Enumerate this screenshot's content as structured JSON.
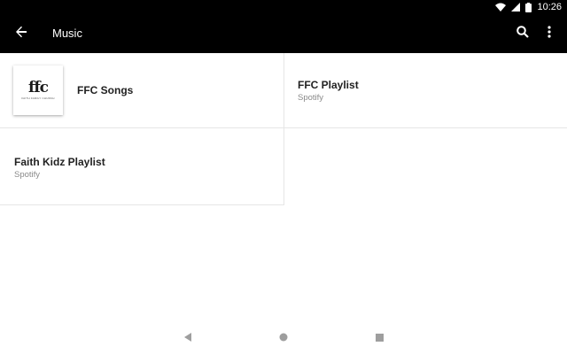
{
  "status_bar": {
    "time": "10:26",
    "icons": [
      "wifi-icon",
      "cell-signal-icon",
      "battery-icon"
    ]
  },
  "app_bar": {
    "title": "Music",
    "icons": [
      "arrow-back-icon",
      "search-icon",
      "more-vert-icon"
    ]
  },
  "tiles": [
    {
      "title": "FFC Songs",
      "subtitle": "",
      "thumbnail_text": "ffc",
      "thumbnail_subtext": "FAITH FAMILY CHURCH"
    },
    {
      "title": "FFC Playlist",
      "subtitle": "Spotify"
    },
    {
      "title": "Faith Kidz Playlist",
      "subtitle": "Spotify"
    }
  ],
  "nav_bar": {
    "icons": [
      "nav-back-icon",
      "nav-home-icon",
      "nav-recents-icon"
    ]
  },
  "colors": {
    "bar_background": "#000000",
    "bar_foreground": "#ffffff",
    "divider": "#e6e6e6",
    "secondary_text": "#8a8a8a",
    "nav_icon": "#9e9e9e"
  }
}
